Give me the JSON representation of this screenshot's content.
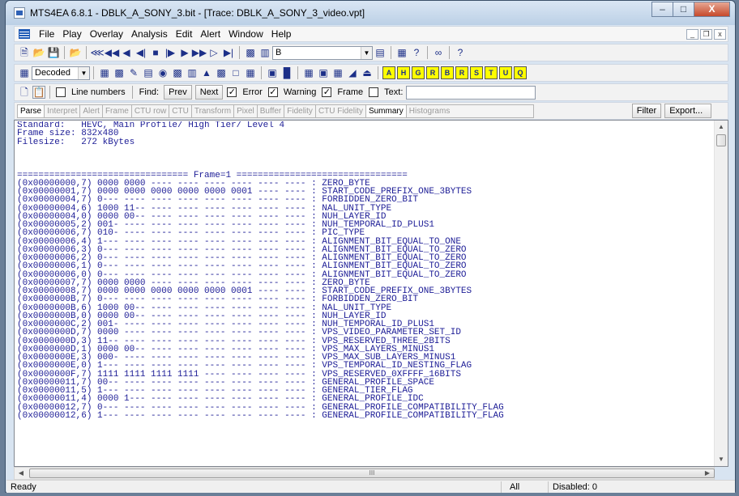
{
  "window": {
    "title": "MTS4EA 6.8.1 - DBLK_A_SONY_3.bit - [Trace: DBLK_A_SONY_3_video.vpt]",
    "minimize": "–",
    "maximize": "□",
    "close": "X"
  },
  "menu": [
    "File",
    "Play",
    "Overlay",
    "Analysis",
    "Edit",
    "Alert",
    "Window",
    "Help"
  ],
  "mdi": {
    "minimize": "_",
    "restore": "❐",
    "close": "x"
  },
  "toolbar1": {
    "frame_type_value": "B"
  },
  "toolbar2": {
    "decoded_select": "Decoded",
    "letters": [
      "A",
      "H",
      "G",
      "R",
      "B",
      "R",
      "S",
      "T",
      "U",
      "Q"
    ]
  },
  "toolbar3": {
    "line_numbers": "Line numbers",
    "find": "Find:",
    "prev": "Prev",
    "next": "Next",
    "error": "Error",
    "warning": "Warning",
    "frame": "Frame",
    "text": "Text:",
    "error_checked": true,
    "warning_checked": true,
    "frame_checked": true,
    "text_checked": false,
    "line_numbers_checked": false
  },
  "tabs": [
    "Parse",
    "Interpret",
    "Alert",
    "Frame",
    "CTU row",
    "CTU",
    "Transform",
    "Pixel",
    "Buffer",
    "Fidelity",
    "CTU Fidelity",
    "Summary",
    "Histograms"
  ],
  "active_tabs": [
    "Parse",
    "Summary"
  ],
  "filter_button": "Filter",
  "export_button": "Export...",
  "trace": {
    "header": [
      "Standard:   HEVC, Main Profile/ High Tier/ Level 4",
      "Frame size: 832x480",
      "Filesize:   272 kBytes",
      "",
      "",
      "",
      "================================ Frame=1 ================================"
    ],
    "rows": [
      [
        "(0x00000000,7)",
        "0000 0000 ---- ---- ---- ---- ---- ----",
        "ZERO_BYTE"
      ],
      [
        "(0x00000001,7)",
        "0000 0000 0000 0000 0000 0001 ---- ----",
        "START_CODE_PREFIX_ONE_3BYTES"
      ],
      [
        "(0x00000004,7)",
        "0--- ---- ---- ---- ---- ---- ---- ----",
        "FORBIDDEN_ZERO_BIT"
      ],
      [
        "(0x00000004,6)",
        "1000 11-- ---- ---- ---- ---- ---- ----",
        "NAL_UNIT_TYPE"
      ],
      [
        "(0x00000004,0)",
        "0000 00-- ---- ---- ---- ---- ---- ----",
        "NUH_LAYER_ID"
      ],
      [
        "(0x00000005,2)",
        "001- ---- ---- ---- ---- ---- ---- ----",
        "NUH_TEMPORAL_ID_PLUS1"
      ],
      [
        "(0x00000006,7)",
        "010- ---- ---- ---- ---- ---- ---- ----",
        "PIC_TYPE"
      ],
      [
        "(0x00000006,4)",
        "1--- ---- ---- ---- ---- ---- ---- ----",
        "ALIGNMENT_BIT_EQUAL_TO_ONE"
      ],
      [
        "(0x00000006,3)",
        "0--- ---- ---- ---- ---- ---- ---- ----",
        "ALIGNMENT_BIT_EQUAL_TO_ZERO"
      ],
      [
        "(0x00000006,2)",
        "0--- ---- ---- ---- ---- ---- ---- ----",
        "ALIGNMENT_BIT_EQUAL_TO_ZERO"
      ],
      [
        "(0x00000006,1)",
        "0--- ---- ---- ---- ---- ---- ---- ----",
        "ALIGNMENT_BIT_EQUAL_TO_ZERO"
      ],
      [
        "(0x00000006,0)",
        "0--- ---- ---- ---- ---- ---- ---- ----",
        "ALIGNMENT_BIT_EQUAL_TO_ZERO"
      ],
      [
        "(0x00000007,7)",
        "0000 0000 ---- ---- ---- ---- ---- ----",
        "ZERO_BYTE"
      ],
      [
        "(0x00000008,7)",
        "0000 0000 0000 0000 0000 0001 ---- ----",
        "START_CODE_PREFIX_ONE_3BYTES"
      ],
      [
        "(0x0000000B,7)",
        "0--- ---- ---- ---- ---- ---- ---- ----",
        "FORBIDDEN_ZERO_BIT"
      ],
      [
        "(0x0000000B,6)",
        "1000 00-- ---- ---- ---- ---- ---- ----",
        "NAL_UNIT_TYPE"
      ],
      [
        "(0x0000000B,0)",
        "0000 00-- ---- ---- ---- ---- ---- ----",
        "NUH_LAYER_ID"
      ],
      [
        "(0x0000000C,2)",
        "001- ---- ---- ---- ---- ---- ---- ----",
        "NUH_TEMPORAL_ID_PLUS1"
      ],
      [
        "(0x0000000D,7)",
        "0000 ---- ---- ---- ---- ---- ---- ----",
        "VPS_VIDEO_PARAMETER_SET_ID"
      ],
      [
        "(0x0000000D,3)",
        "11-- ---- ---- ---- ---- ---- ---- ----",
        "VPS_RESERVED_THREE_2BITS"
      ],
      [
        "(0x0000000D,1)",
        "0000 00-- ---- ---- ---- ---- ---- ----",
        "VPS_MAX_LAYERS_MINUS1"
      ],
      [
        "(0x0000000E,3)",
        "000- ---- ---- ---- ---- ---- ---- ----",
        "VPS_MAX_SUB_LAYERS_MINUS1"
      ],
      [
        "(0x0000000E,0)",
        "1--- ---- ---- ---- ---- ---- ---- ----",
        "VPS_TEMPORAL_ID_NESTING_FLAG"
      ],
      [
        "(0x0000000F,7)",
        "1111 1111 1111 1111 ---- ---- ---- ----",
        "VPS_RESERVED_0XFFFF_16BITS"
      ],
      [
        "(0x00000011,7)",
        "00-- ---- ---- ---- ---- ---- ---- ----",
        "GENERAL_PROFILE_SPACE"
      ],
      [
        "(0x00000011,5)",
        "1--- ---- ---- ---- ---- ---- ---- ----",
        "GENERAL_TIER_FLAG"
      ],
      [
        "(0x00000011,4)",
        "0000 1--- ---- ---- ---- ---- ---- ----",
        "GENERAL_PROFILE_IDC"
      ],
      [
        "(0x00000012,7)",
        "0--- ---- ---- ---- ---- ---- ---- ----",
        "GENERAL_PROFILE_COMPATIBILITY_FLAG"
      ],
      [
        "(0x00000012,6)",
        "1--- ---- ---- ---- ---- ---- ---- ----",
        "GENERAL_PROFILE_COMPATIBILITY_FLAG"
      ]
    ]
  },
  "hscroll_grip": "III",
  "statusbar": {
    "left": "Ready",
    "mode": "All",
    "disabled": "Disabled: 0"
  }
}
